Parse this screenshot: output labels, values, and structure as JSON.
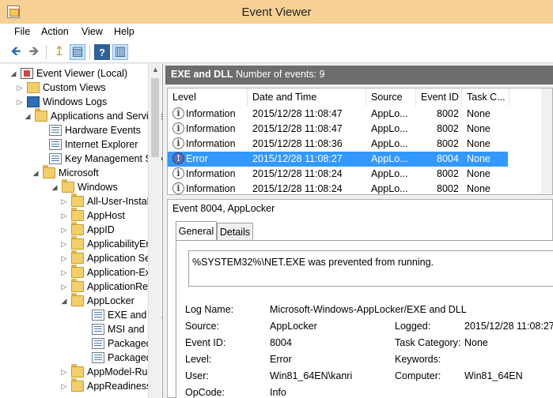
{
  "window": {
    "title": "Event Viewer"
  },
  "menu": [
    "File",
    "Action",
    "View",
    "Help"
  ],
  "toolbar": {
    "buttons": [
      {
        "name": "back-icon",
        "glyph": "🡸"
      },
      {
        "name": "forward-icon",
        "glyph": "🡺"
      },
      {
        "name": "up-folder-icon",
        "glyph": "↥"
      },
      {
        "name": "show-hide-tree-icon",
        "glyph": "▤"
      },
      {
        "name": "help-icon",
        "glyph": "?"
      },
      {
        "name": "show-hide-action-pane-icon",
        "glyph": "▥"
      }
    ]
  },
  "tree": [
    {
      "label": "Event Viewer (Local)",
      "icon": "viewer",
      "exp": "◢"
    },
    {
      "label": "Custom Views",
      "icon": "custom",
      "exp": "▷"
    },
    {
      "label": "Windows Logs",
      "icon": "winlogs",
      "exp": "▷"
    },
    {
      "label": "Applications and Services",
      "icon": "folder",
      "exp": "◢"
    },
    {
      "label": "Hardware Events",
      "icon": "log",
      "exp": ""
    },
    {
      "label": "Internet Explorer",
      "icon": "log",
      "exp": ""
    },
    {
      "label": "Key Management Serv",
      "icon": "log",
      "exp": ""
    },
    {
      "label": "Microsoft",
      "icon": "folder",
      "exp": "◢"
    },
    {
      "label": "Windows",
      "icon": "folder",
      "exp": "◢"
    },
    {
      "label": "All-User-Instal",
      "icon": "folder",
      "exp": "▷"
    },
    {
      "label": "AppHost",
      "icon": "folder",
      "exp": "▷"
    },
    {
      "label": "AppID",
      "icon": "folder",
      "exp": "▷"
    },
    {
      "label": "ApplicabilityEr",
      "icon": "folder",
      "exp": "▷"
    },
    {
      "label": "Application Se",
      "icon": "folder",
      "exp": "▷"
    },
    {
      "label": "Application-Ex",
      "icon": "folder",
      "exp": "▷"
    },
    {
      "label": "ApplicationRes",
      "icon": "folder",
      "exp": "▷"
    },
    {
      "label": "AppLocker",
      "icon": "folder",
      "exp": "◢"
    },
    {
      "label": "EXE and DL",
      "icon": "log",
      "exp": ""
    },
    {
      "label": "MSI and Sc",
      "icon": "log",
      "exp": ""
    },
    {
      "label": "Packaged a",
      "icon": "log",
      "exp": ""
    },
    {
      "label": "Packaged a",
      "icon": "log",
      "exp": ""
    },
    {
      "label": "AppModel-Ru",
      "icon": "folder",
      "exp": "▷"
    },
    {
      "label": "AppReadiness",
      "icon": "folder",
      "exp": "▷"
    }
  ],
  "header": {
    "name": "EXE and DLL",
    "count": "Number of events: 9"
  },
  "columns": [
    "Level",
    "Date and Time",
    "Source",
    "Event ID",
    "Task C..."
  ],
  "events": [
    {
      "level": "Information",
      "date": "2015/12/28 11:08:47",
      "source": "AppLo...",
      "id": "8002",
      "task": "None",
      "selected": false
    },
    {
      "level": "Information",
      "date": "2015/12/28 11:08:47",
      "source": "AppLo...",
      "id": "8002",
      "task": "None",
      "selected": false
    },
    {
      "level": "Information",
      "date": "2015/12/28 11:08:36",
      "source": "AppLo...",
      "id": "8002",
      "task": "None",
      "selected": false
    },
    {
      "level": "Error",
      "date": "2015/12/28 11:08:27",
      "source": "AppLo...",
      "id": "8004",
      "task": "None",
      "selected": true
    },
    {
      "level": "Information",
      "date": "2015/12/28 11:08:24",
      "source": "AppLo...",
      "id": "8002",
      "task": "None",
      "selected": false
    },
    {
      "level": "Information",
      "date": "2015/12/28 11:08:24",
      "source": "AppLo...",
      "id": "8002",
      "task": "None",
      "selected": false
    }
  ],
  "detail": {
    "title": "Event 8004, AppLocker",
    "tabs": [
      "General",
      "Details"
    ],
    "message": "%SYSTEM32%\\NET.EXE was prevented from running.",
    "fields": {
      "log_name_label": "Log Name:",
      "log_name": "Microsoft-Windows-AppLocker/EXE and DLL",
      "source_label": "Source:",
      "source": "AppLocker",
      "logged_label": "Logged:",
      "logged": "2015/12/28 11:08:27",
      "event_id_label": "Event ID:",
      "event_id": "8004",
      "task_label": "Task Category:",
      "task": "None",
      "level_label": "Level:",
      "level": "Error",
      "keywords_label": "Keywords:",
      "keywords": "",
      "user_label": "User:",
      "user": "Win81_64EN\\kanri",
      "computer_label": "Computer:",
      "computer": "Win81_64EN",
      "opcode_label": "OpCode:",
      "opcode": "Info"
    }
  },
  "colors": {
    "title_bar": "#f6d193",
    "selection": "#3399ff",
    "pane_header": "#6d6d6d"
  }
}
